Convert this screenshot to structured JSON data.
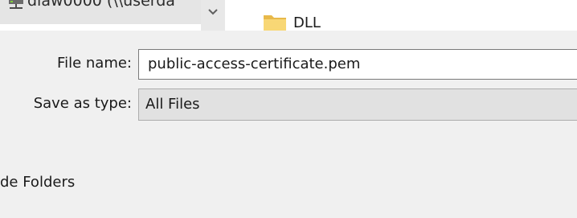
{
  "navigation_pane": {
    "drive_label": "dlaw0000 (\\\\userda",
    "drive_icon": "network-drive-icon",
    "scroll_icon": "chevron-down-icon"
  },
  "file_list": {
    "items": [
      {
        "name": "DLL",
        "icon": "folder-icon"
      }
    ]
  },
  "form": {
    "file_name_label": "File name:",
    "file_name_value": "public-access-certificate.pem",
    "save_as_type_label": "Save as type:",
    "save_as_type_value": "All Files"
  },
  "footer": {
    "hide_folders_label": "de Folders"
  },
  "colors": {
    "dialog_bg": "#f0f0f0",
    "list_bg": "#ffffff",
    "selected_bg": "#e5e5e5",
    "folder_yellow": "#f8d775"
  }
}
